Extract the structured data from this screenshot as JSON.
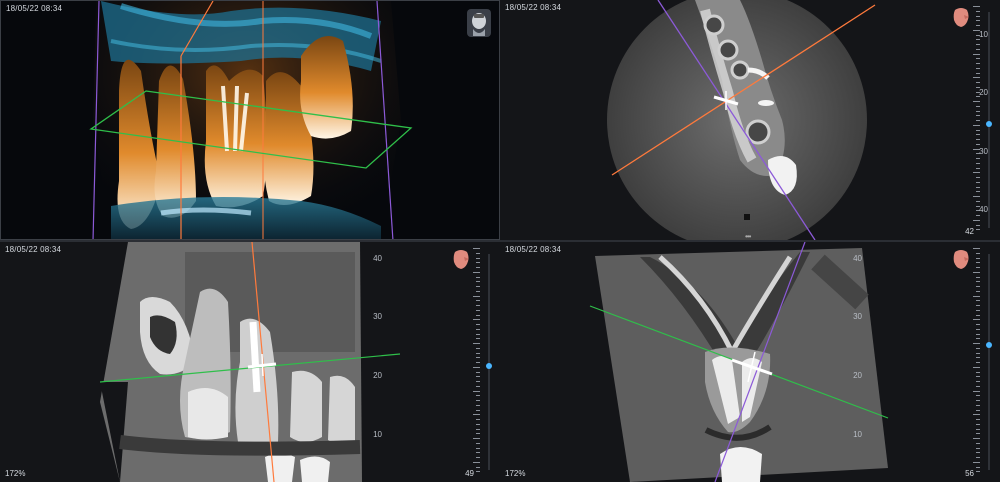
{
  "viewports": [
    {
      "id": "3d",
      "timestamp": "18/05/22 08:34"
    },
    {
      "id": "axial",
      "timestamp": "18/05/22 08:34",
      "slice": "42",
      "scale_labels": [
        "10",
        "20",
        "30",
        "40"
      ]
    },
    {
      "id": "sagittal",
      "timestamp": "18/05/22 08:34",
      "zoom": "172%",
      "slice": "49",
      "scale_labels": [
        "40",
        "30",
        "20",
        "10"
      ]
    },
    {
      "id": "coronal",
      "timestamp": "18/05/22 08:34",
      "zoom": "172%",
      "slice": "56",
      "scale_labels": [
        "40",
        "30",
        "20",
        "10"
      ]
    }
  ],
  "slider_levels": {
    "axial": 0.52,
    "sagittal": 0.52,
    "coronal": 0.42
  },
  "colors": {
    "orange_line": "#ff7a3c",
    "purple_line": "#8c5ad8",
    "green_line": "#2fbf4a",
    "slider": "#4ab6ff"
  }
}
